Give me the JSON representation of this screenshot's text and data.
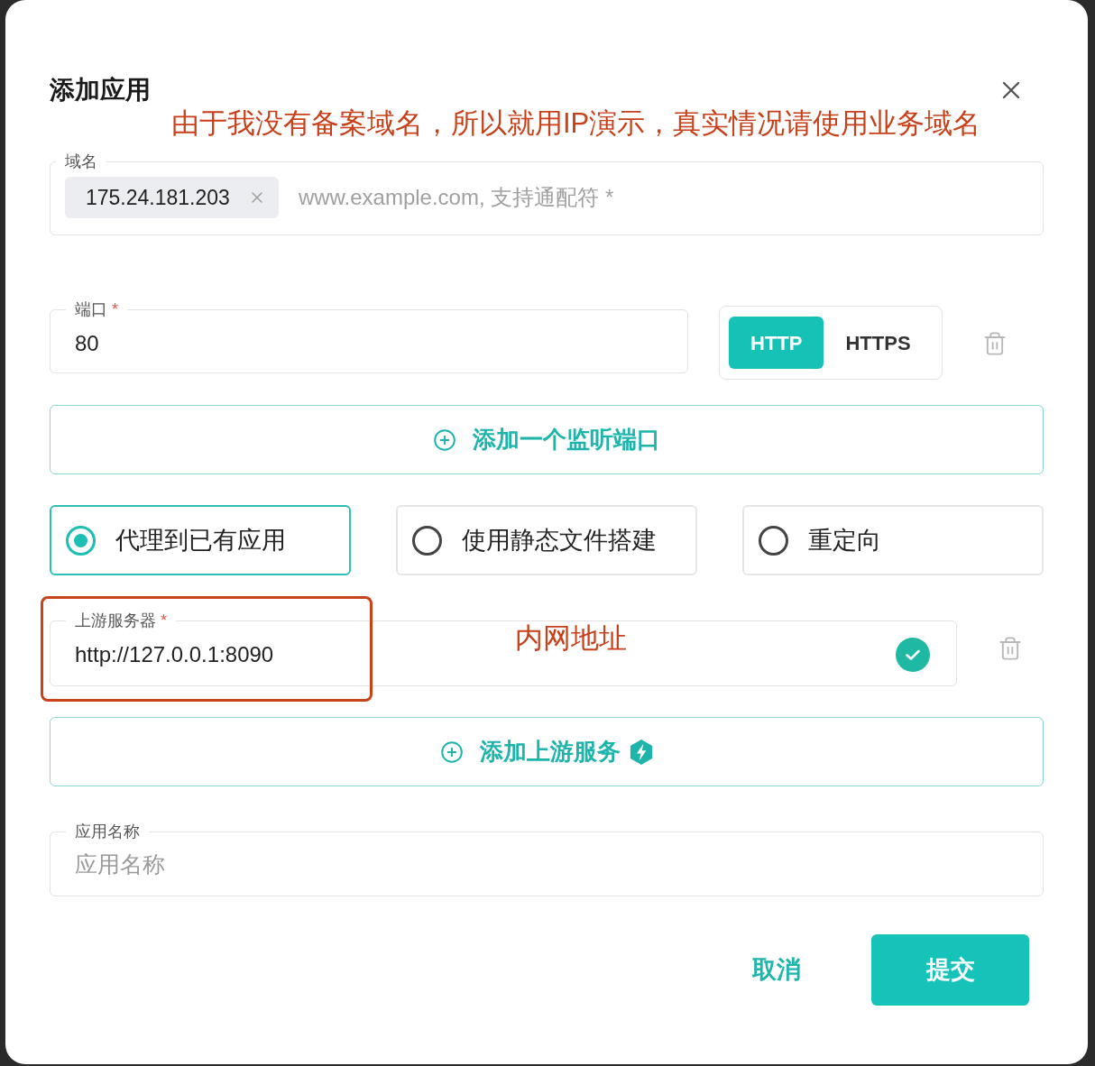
{
  "dialog": {
    "title": "添加应用"
  },
  "annotation_note": "由于我没有备案域名，所以就用IP演示，真实情况请使用业务域名",
  "domain": {
    "label": "域名",
    "tags": [
      "175.24.181.203"
    ],
    "placeholder": "www.example.com, 支持通配符 *"
  },
  "ports": [
    {
      "label": "端口",
      "required_mark": "*",
      "value": "80",
      "protocols": [
        {
          "label": "HTTP",
          "selected": true
        },
        {
          "label": "HTTPS",
          "selected": false
        }
      ]
    }
  ],
  "add_port_button": "添加一个监听端口",
  "modes": [
    {
      "label": "代理到已有应用",
      "selected": true
    },
    {
      "label": "使用静态文件搭建",
      "selected": false
    },
    {
      "label": "重定向",
      "selected": false
    }
  ],
  "upstreams": [
    {
      "label": "上游服务器",
      "required_mark": "*",
      "value": "http://127.0.0.1:8090",
      "valid": true,
      "highlighted": true,
      "note": "内网地址"
    }
  ],
  "add_upstream_button": "添加上游服务",
  "app_name": {
    "label": "应用名称",
    "placeholder": "应用名称"
  },
  "footer": {
    "cancel": "取消",
    "submit": "提交"
  }
}
